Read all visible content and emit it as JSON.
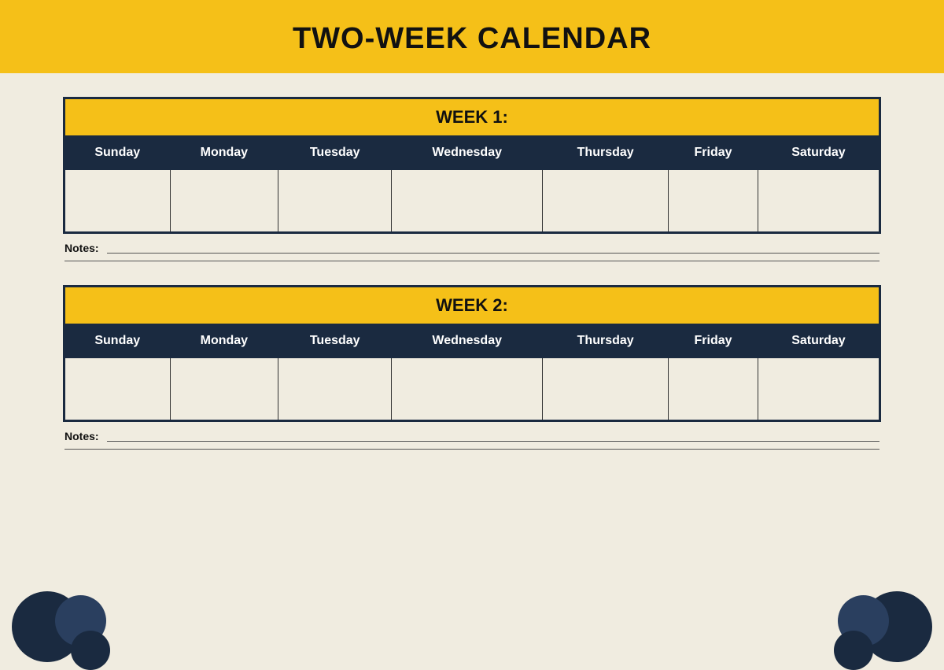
{
  "header": {
    "title": "TWO-WEEK CALENDAR"
  },
  "week1": {
    "label": "WEEK 1:",
    "days": [
      "Sunday",
      "Monday",
      "Tuesday",
      "Wednesday",
      "Thursday",
      "Friday",
      "Saturday"
    ],
    "notes_label": "Notes:"
  },
  "week2": {
    "label": "WEEK 2:",
    "days": [
      "Sunday",
      "Monday",
      "Tuesday",
      "Wednesday",
      "Thursday",
      "Friday",
      "Saturday"
    ],
    "notes_label": "Notes:"
  }
}
